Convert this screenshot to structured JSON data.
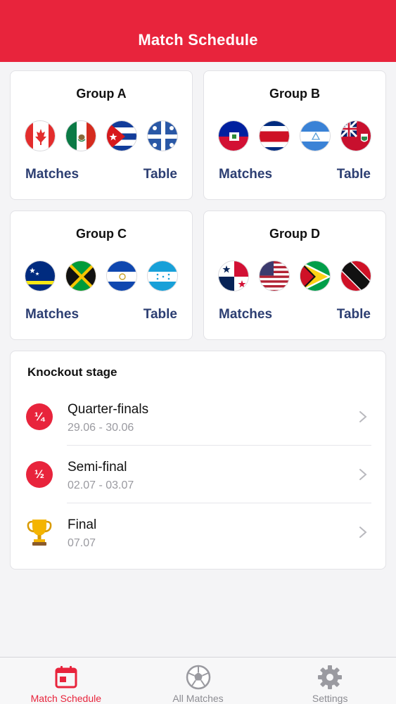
{
  "header": {
    "title": "Match Schedule"
  },
  "groups": [
    {
      "title": "Group A",
      "matches_label": "Matches",
      "table_label": "Table",
      "flags": [
        "canada-flag-icon",
        "mexico-flag-icon",
        "cuba-flag-icon",
        "martinique-flag-icon"
      ]
    },
    {
      "title": "Group B",
      "matches_label": "Matches",
      "table_label": "Table",
      "flags": [
        "haiti-flag-icon",
        "costa-rica-flag-icon",
        "nicaragua-flag-icon",
        "bermuda-flag-icon"
      ]
    },
    {
      "title": "Group C",
      "matches_label": "Matches",
      "table_label": "Table",
      "flags": [
        "curacao-flag-icon",
        "jamaica-flag-icon",
        "el-salvador-flag-icon",
        "honduras-flag-icon"
      ]
    },
    {
      "title": "Group D",
      "matches_label": "Matches",
      "table_label": "Table",
      "flags": [
        "panama-flag-icon",
        "usa-flag-icon",
        "guyana-flag-icon",
        "trinidad-tobago-flag-icon"
      ]
    }
  ],
  "knockout": {
    "title": "Knockout stage",
    "rounds": [
      {
        "badge": "¼",
        "name": "Quarter-finals",
        "dates": "29.06 - 30.06",
        "icon": "quarter-badge-icon"
      },
      {
        "badge": "½",
        "name": "Semi-final",
        "dates": "02.07 - 03.07",
        "icon": "half-badge-icon"
      },
      {
        "badge": "",
        "name": "Final",
        "dates": "07.07",
        "icon": "trophy-icon"
      }
    ]
  },
  "tabs": [
    {
      "label": "Match Schedule",
      "icon": "calendar-icon",
      "active": true
    },
    {
      "label": "All Matches",
      "icon": "soccer-ball-icon",
      "active": false
    },
    {
      "label": "Settings",
      "icon": "gear-icon",
      "active": false
    }
  ],
  "colors": {
    "accent": "#e8243c",
    "link": "#2c3e72",
    "muted": "#9a9aa0"
  }
}
